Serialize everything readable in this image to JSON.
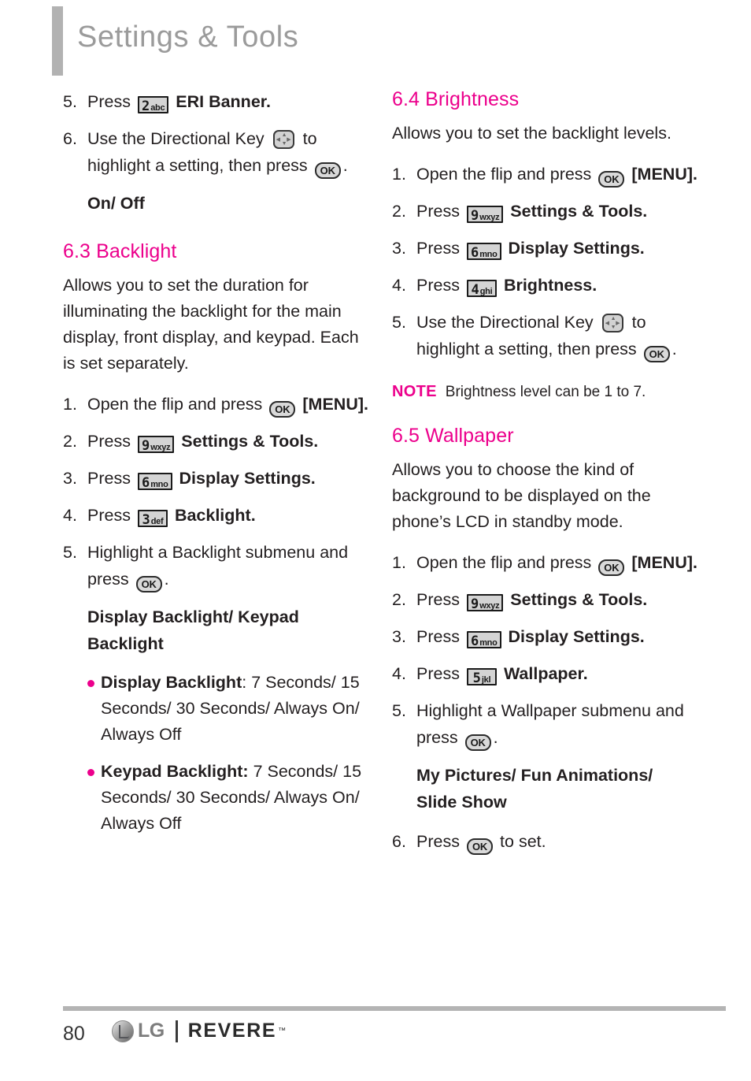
{
  "header": {
    "title": "Settings & Tools"
  },
  "left_column": {
    "step5_eri": {
      "num": "5.",
      "press": "Press",
      "key": {
        "digit": "2",
        "letters": "abc"
      },
      "label": "ERI Banner."
    },
    "step6_dirkey": {
      "num": "6.",
      "text_before": "Use the Directional Key",
      "text_mid": "to highlight a setting, then press",
      "ok": "OK",
      "period": "."
    },
    "onoff": "On/ Off",
    "backlight_heading": "6.3 Backlight",
    "backlight_desc": "Allows you to set the duration for illuminating the backlight for the main display, front display, and keypad. Each is set separately.",
    "steps": [
      {
        "num": "1.",
        "before": "Open the flip and press",
        "ok": "OK",
        "after": "[MENU]."
      },
      {
        "num": "2.",
        "before": "Press",
        "key": {
          "digit": "9",
          "letters": "wxyz"
        },
        "after": "Settings & Tools."
      },
      {
        "num": "3.",
        "before": "Press",
        "key": {
          "digit": "6",
          "letters": "mno"
        },
        "after": "Display Settings."
      },
      {
        "num": "4.",
        "before": "Press",
        "key": {
          "digit": "3",
          "letters": "def"
        },
        "after": "Backlight."
      },
      {
        "num": "5.",
        "before": "Highlight a Backlight submenu and press",
        "ok": "OK",
        "after": "."
      }
    ],
    "submenu_title": "Display Backlight/ Keypad Backlight",
    "bullets": [
      {
        "label": "Display Backlight",
        "sep": ": ",
        "value": "7 Seconds/ 15 Seconds/ 30 Seconds/ Always On/ Always Off"
      },
      {
        "label": "Keypad Backlight:",
        "sep": " ",
        "value": "7 Seconds/ 15 Seconds/ 30 Seconds/ Always On/ Always Off"
      }
    ]
  },
  "right_column": {
    "brightness_heading": "6.4 Brightness",
    "brightness_desc": "Allows you to set the backlight levels.",
    "brightness_steps": [
      {
        "num": "1.",
        "before": "Open the flip and press",
        "ok": "OK",
        "after": "[MENU]."
      },
      {
        "num": "2.",
        "before": "Press",
        "key": {
          "digit": "9",
          "letters": "wxyz"
        },
        "after": "Settings & Tools."
      },
      {
        "num": "3.",
        "before": "Press",
        "key": {
          "digit": "6",
          "letters": "mno"
        },
        "after": "Display Settings."
      },
      {
        "num": "4.",
        "before": "Press",
        "key": {
          "digit": "4",
          "letters": "ghi"
        },
        "after": "Brightness."
      },
      {
        "num": "5.",
        "before": "Use the Directional Key",
        "mid": "to highlight a setting, then press",
        "ok": "OK",
        "after": "."
      }
    ],
    "note": {
      "label": "NOTE",
      "text": "Brightness level can be 1 to 7."
    },
    "wallpaper_heading": "6.5 Wallpaper",
    "wallpaper_desc": "Allows you to choose the kind of background to be displayed on the phone’s LCD in standby mode.",
    "wallpaper_steps": [
      {
        "num": "1.",
        "before": "Open the flip and press",
        "ok": "OK",
        "after": "[MENU]."
      },
      {
        "num": "2.",
        "before": "Press",
        "key": {
          "digit": "9",
          "letters": "wxyz"
        },
        "after": "Settings & Tools."
      },
      {
        "num": "3.",
        "before": "Press",
        "key": {
          "digit": "6",
          "letters": "mno"
        },
        "after": "Display Settings."
      },
      {
        "num": "4.",
        "before": "Press",
        "key": {
          "digit": "5",
          "letters": "jkl"
        },
        "after": "Wallpaper."
      },
      {
        "num": "5.",
        "before": "Highlight a Wallpaper submenu and press",
        "ok": "OK",
        "after": "."
      }
    ],
    "wallpaper_submenu": "My Pictures/ Fun Animations/ Slide Show",
    "wallpaper_step6": {
      "num": "6.",
      "before": "Press",
      "ok": "OK",
      "after": "to set."
    }
  },
  "footer": {
    "page_number": "80",
    "brand": "LG",
    "model": "REVERE",
    "trademark": "™"
  },
  "colors": {
    "accent": "#ec008c",
    "header_gray": "#9b9b9b",
    "bar_gray": "#b2b2b2",
    "text": "#231f20"
  }
}
